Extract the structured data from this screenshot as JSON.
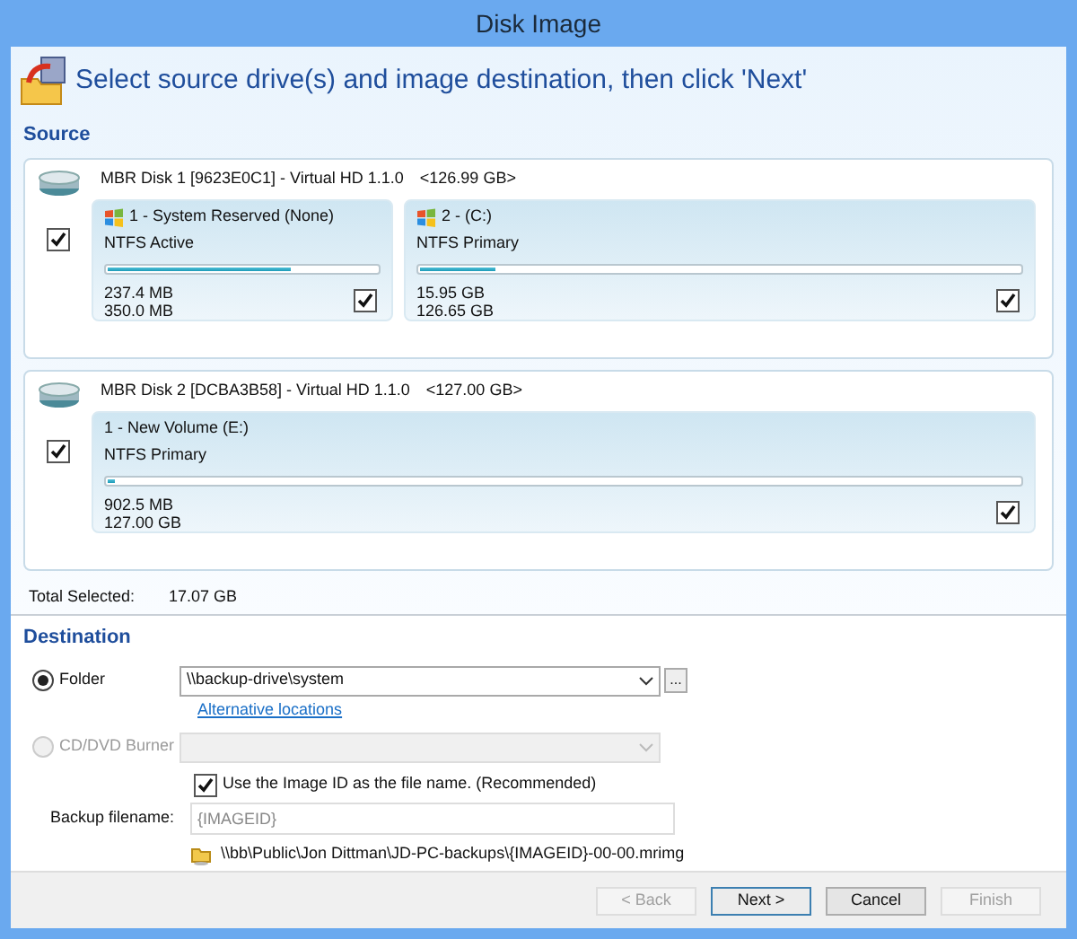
{
  "window": {
    "title": "Disk Image"
  },
  "heading": "Select source drive(s) and image destination, then click 'Next'",
  "source": {
    "label": "Source",
    "disks": [
      {
        "title": "MBR Disk 1 [9623E0C1] - Virtual HD 1.1.0",
        "size": "<126.99 GB>",
        "checked": true,
        "partitions": [
          {
            "name": "1 - System Reserved (None)",
            "type": "NTFS Active",
            "windows_logo": true,
            "level": 0.68,
            "used": "237.4 MB",
            "total": "350.0 MB",
            "checked": true,
            "grow": false
          },
          {
            "name": "2 -  (C:)",
            "type": "NTFS Primary",
            "windows_logo": true,
            "level": 0.126,
            "used": "15.95 GB",
            "total": "126.65 GB",
            "checked": true,
            "grow": true
          }
        ]
      },
      {
        "title": "MBR Disk 2 [DCBA3B58] - Virtual HD 1.1.0",
        "size": "<127.00 GB>",
        "checked": true,
        "partitions": [
          {
            "name": "1 - New Volume (E:)",
            "type": "NTFS Primary",
            "windows_logo": false,
            "level": 0.007,
            "used": "902.5 MB",
            "total": "127.00 GB",
            "checked": true,
            "grow": true
          }
        ]
      }
    ],
    "total_label": "Total Selected:",
    "total_value": "17.07 GB"
  },
  "destination": {
    "label": "Destination",
    "options": [
      {
        "label": "Folder",
        "selected": true,
        "disabled": false,
        "value": "\\\\backup-drive\\system",
        "browse": "...",
        "link": "Alternative locations"
      },
      {
        "label": "CD/DVD Burner",
        "selected": false,
        "disabled": true
      }
    ],
    "use_image_id": {
      "label": "Use the Image ID as the file name.  (Recommended)",
      "checked": true
    },
    "filename_label": "Backup filename:",
    "filename_placeholder": "{IMAGEID}",
    "path": "\\\\bb\\Public\\Jon Dittman\\JD-PC-backups\\{IMAGEID}-00-00.mrimg"
  },
  "buttons": [
    {
      "label": "< Back",
      "disabled": true,
      "default": false
    },
    {
      "label": "Next >",
      "disabled": false,
      "default": true
    },
    {
      "label": "Cancel",
      "disabled": false,
      "default": false
    },
    {
      "label": "Finish",
      "disabled": true,
      "default": false
    }
  ]
}
